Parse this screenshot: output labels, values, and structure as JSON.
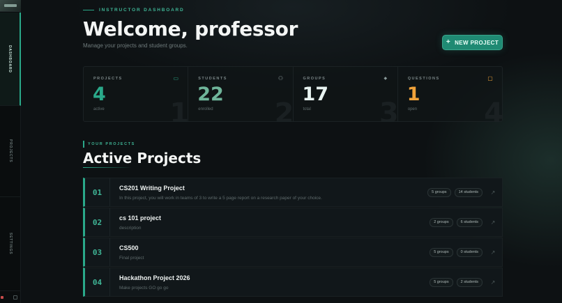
{
  "sidebar": {
    "items": [
      {
        "label": "DASHBOARD"
      },
      {
        "label": "PROJECTS"
      },
      {
        "label": "SETTINGS"
      }
    ]
  },
  "header": {
    "kicker": "INSTRUCTOR DASHBOARD",
    "title": "Welcome, professor",
    "subtitle": "Manage your projects and student groups.",
    "new_button": "NEW PROJECT"
  },
  "stats": [
    {
      "label": "PROJECTS",
      "value": "4",
      "sub": "active",
      "ghost": "1",
      "color": "#2aa98a",
      "icon": "folder-icon",
      "glyph": "▭"
    },
    {
      "label": "STUDENTS",
      "value": "22",
      "sub": "enrolled",
      "ghost": "2",
      "color": "#6fb59a",
      "icon": "users-icon",
      "glyph": "⚇"
    },
    {
      "label": "GROUPS",
      "value": "17",
      "sub": "total",
      "ghost": "3",
      "color": "#e8f3f1",
      "icon": "network-icon",
      "glyph": "◆"
    },
    {
      "label": "QUESTIONS",
      "value": "1",
      "sub": "open",
      "ghost": "4",
      "color": "#f0a23a",
      "icon": "chat-icon",
      "glyph": "▢"
    }
  ],
  "section": {
    "kicker": "YOUR PROJECTS",
    "title": "Active Projects"
  },
  "projects": [
    {
      "num": "01",
      "name": "CS201 Writing Project",
      "desc": "In this project, you will work in teams of 3 to write a 5 page report on a research paper of your choice.",
      "groups": "5 groups",
      "students": "14 students"
    },
    {
      "num": "02",
      "name": "cs 101 project",
      "desc": "description",
      "groups": "2 groups",
      "students": "6 students"
    },
    {
      "num": "03",
      "name": "CS500",
      "desc": "Final project",
      "groups": "5 groups",
      "students": "0 students"
    },
    {
      "num": "04",
      "name": "Hackathon Project 2026",
      "desc": "Make projects GO go go",
      "groups": "5 groups",
      "students": "2 students"
    }
  ],
  "colors": {
    "accent": "#2aa98a",
    "questions": "#f0a23a"
  }
}
